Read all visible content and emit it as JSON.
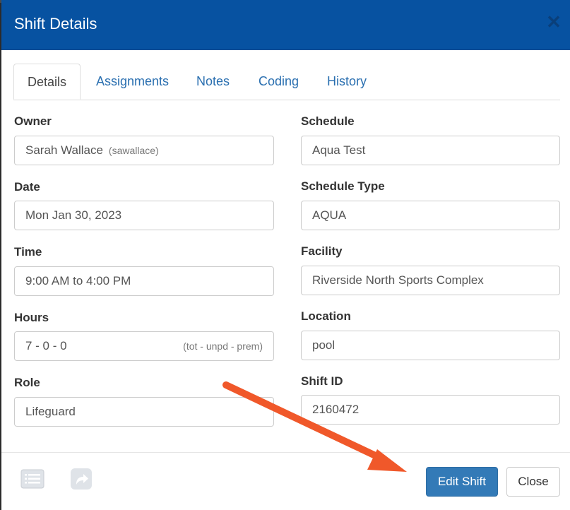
{
  "modal": {
    "title": "Shift Details"
  },
  "tabs": [
    {
      "label": "Details"
    },
    {
      "label": "Assignments"
    },
    {
      "label": "Notes"
    },
    {
      "label": "Coding"
    },
    {
      "label": "History"
    }
  ],
  "fields": {
    "owner": {
      "label": "Owner",
      "value": "Sarah Wallace",
      "username": "(sawallace)"
    },
    "date": {
      "label": "Date",
      "value": "Mon Jan 30, 2023"
    },
    "time": {
      "label": "Time",
      "value": "9:00 AM to 4:00 PM"
    },
    "hours": {
      "label": "Hours",
      "value": "7 - 0 - 0",
      "hint": "(tot - unpd - prem)"
    },
    "role": {
      "label": "Role",
      "value": "Lifeguard"
    },
    "schedule": {
      "label": "Schedule",
      "value": "Aqua Test"
    },
    "schedule_type": {
      "label": "Schedule Type",
      "value": "AQUA"
    },
    "facility": {
      "label": "Facility",
      "value": "Riverside North Sports Complex"
    },
    "location": {
      "label": "Location",
      "value": "pool"
    },
    "shift_id": {
      "label": "Shift ID",
      "value": "2160472"
    }
  },
  "footer": {
    "edit_label": "Edit Shift",
    "close_label": "Close",
    "icons": [
      "list-icon",
      "share-icon"
    ]
  },
  "colors": {
    "header": "#0752a1",
    "primary_button": "#337ab7",
    "tab_link": "#2a6fb0",
    "annotation_arrow": "#f0582a"
  }
}
